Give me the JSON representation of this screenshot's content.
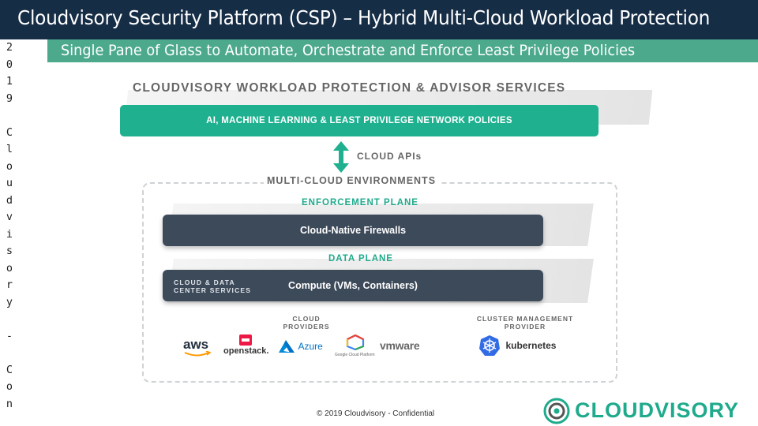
{
  "slide": {
    "title": "Cloudvisory Security Platform (CSP) – Hybrid Multi-Cloud Workload Protection",
    "subtitle": "Single Pane of Glass to Automate, Orchestrate and Enforce Least Privilege Policies",
    "vertical_text": [
      "2",
      "0",
      "1",
      "9",
      "",
      "C",
      "l",
      "o",
      "u",
      "d",
      "v",
      "i",
      "s",
      "o",
      "r",
      "y",
      "",
      "-",
      "",
      "C",
      "o",
      "n"
    ],
    "footer": "© 2019 Cloudvisory - Confidential",
    "brand": "CLOUDVISORY"
  },
  "diagram": {
    "services_heading": "CLOUDVISORY WORKLOAD PROTECTION & ADVISOR SERVICES",
    "ai_bar": "AI, MACHINE LEARNING & LEAST PRIVILEGE NETWORK POLICIES",
    "cloud_apis": "CLOUD APIs",
    "multicloud_heading": "MULTI-CLOUD ENVIRONMENTS",
    "enforcement_heading": "ENFORCEMENT PLANE",
    "firewalls_bar": "Cloud-Native Firewalls",
    "data_plane_heading": "DATA PLANE",
    "cloud_dc_label": "CLOUD & DATA CENTER SERVICES",
    "compute_bar": "Compute (VMs, Containers)",
    "cloud_providers_heading": "CLOUD PROVIDERS",
    "cluster_mgmt_heading": "CLUSTER MANAGEMENT PROVIDER",
    "logos": {
      "aws": "aws",
      "openstack": "openstack.",
      "azure": "Azure",
      "google": "Google Cloud Platform",
      "vmware": "vmware",
      "kubernetes": "kubernetes"
    }
  },
  "colors": {
    "title_bg": "#162d46",
    "subtitle_bg": "#4da98c",
    "accent_green": "#1fb08f",
    "dark_bar": "#3d4a5a"
  }
}
